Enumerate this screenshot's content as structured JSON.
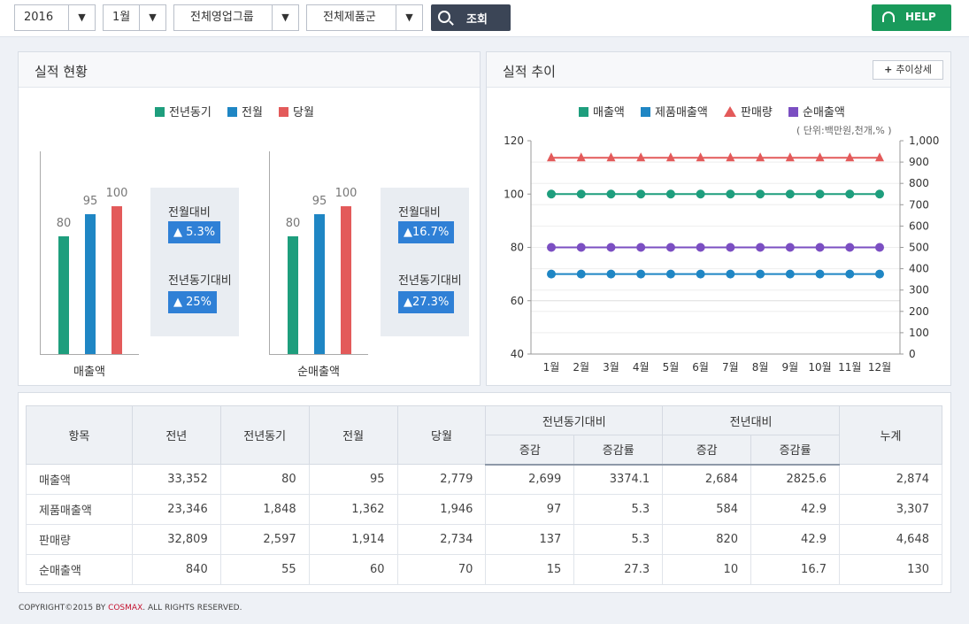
{
  "toolbar": {
    "year": "2016",
    "month": "1월",
    "group": "전체영업그룹",
    "product": "전체제품군",
    "search_label": "조회",
    "help_label": "HELP"
  },
  "status_panel": {
    "title": "실적 현황",
    "legend": [
      {
        "label": "전년동기",
        "color": "#1e9e7d"
      },
      {
        "label": "전월",
        "color": "#1f86c4"
      },
      {
        "label": "당월",
        "color": "#e35a5a"
      }
    ],
    "groups": [
      {
        "name": "매출액",
        "values": [
          80,
          95,
          100
        ],
        "cmp": [
          {
            "label": "전월대비",
            "value": "▲ 5.3%"
          },
          {
            "label": "전년동기대비",
            "value": "▲ 25%"
          }
        ]
      },
      {
        "name": "순매출액",
        "values": [
          80,
          95,
          100
        ],
        "cmp": [
          {
            "label": "전월대비",
            "value": "▲16.7%"
          },
          {
            "label": "전년동기대비",
            "value": "▲27.3%"
          }
        ]
      }
    ]
  },
  "trend_panel": {
    "title": "실적 추이",
    "detail_button": "추이상세",
    "unit": "( 단위:백만원,천개,% )",
    "legend": [
      {
        "label": "매출액",
        "color": "#1e9e7d",
        "shape": "square"
      },
      {
        "label": "제품매출액",
        "color": "#1f86c4",
        "shape": "square"
      },
      {
        "label": "판매량",
        "color": "#e35a5a",
        "shape": "triangle"
      },
      {
        "label": "순매출액",
        "color": "#7b4fc2",
        "shape": "square"
      }
    ]
  },
  "chart_data": [
    {
      "type": "bar",
      "categories": [
        "매출액",
        "순매출액"
      ],
      "series": [
        {
          "name": "전년동기",
          "values": [
            80,
            80
          ]
        },
        {
          "name": "전월",
          "values": [
            95,
            95
          ]
        },
        {
          "name": "당월",
          "values": [
            100,
            100
          ]
        }
      ],
      "ylim": [
        0,
        120
      ]
    },
    {
      "type": "line",
      "x": [
        "1월",
        "2월",
        "3월",
        "4월",
        "5월",
        "6월",
        "7월",
        "8월",
        "9월",
        "10월",
        "11월",
        "12월"
      ],
      "y_left_ticks": [
        "40",
        "60",
        "80",
        "100",
        "120"
      ],
      "y_right_ticks": [
        "0",
        "100",
        "200",
        "300",
        "400",
        "500",
        "600",
        "700",
        "800",
        "900",
        "1,000"
      ],
      "ylim_left": [
        40,
        120
      ],
      "ylim_right": [
        0,
        1000
      ],
      "series": [
        {
          "name": "매출액",
          "axis": "left",
          "color": "#1e9e7d",
          "marker": "circle",
          "values": [
            100,
            100,
            100,
            100,
            100,
            100,
            100,
            100,
            100,
            100,
            100,
            100
          ]
        },
        {
          "name": "제품매출액",
          "axis": "left",
          "color": "#1f86c4",
          "marker": "circle",
          "values": [
            70,
            70,
            70,
            70,
            70,
            70,
            70,
            70,
            70,
            70,
            70,
            70
          ]
        },
        {
          "name": "판매량",
          "axis": "right",
          "color": "#e35a5a",
          "marker": "triangle",
          "values": [
            920,
            920,
            920,
            920,
            920,
            920,
            920,
            920,
            920,
            920,
            920,
            920
          ]
        },
        {
          "name": "순매출액",
          "axis": "left",
          "color": "#7b4fc2",
          "marker": "circle",
          "values": [
            80,
            80,
            80,
            80,
            80,
            80,
            80,
            80,
            80,
            80,
            80,
            80
          ]
        }
      ]
    }
  ],
  "table": {
    "headers": {
      "item": "항목",
      "prev_year": "전년",
      "prev_year_same": "전년동기",
      "prev_month": "전월",
      "this_month": "당월",
      "yoy_same": "전년동기대비",
      "yoy": "전년대비",
      "change": "증감",
      "rate": "증감률",
      "total": "누계"
    },
    "rows": [
      [
        "매출액",
        "33,352",
        "80",
        "95",
        "2,779",
        "2,699",
        "3374.1",
        "2,684",
        "2825.6",
        "2,874"
      ],
      [
        "제품매출액",
        "23,346",
        "1,848",
        "1,362",
        "1,946",
        "97",
        "5.3",
        "584",
        "42.9",
        "3,307"
      ],
      [
        "판매량",
        "32,809",
        "2,597",
        "1,914",
        "2,734",
        "137",
        "5.3",
        "820",
        "42.9",
        "4,648"
      ],
      [
        "순매출액",
        "840",
        "55",
        "60",
        "70",
        "15",
        "27.3",
        "10",
        "16.7",
        "130"
      ]
    ]
  },
  "footer": {
    "prefix": "COPYRIGHT©2015 BY ",
    "brand": "COSMAX",
    "suffix": ". ALL RIGHTS RESERVED."
  }
}
